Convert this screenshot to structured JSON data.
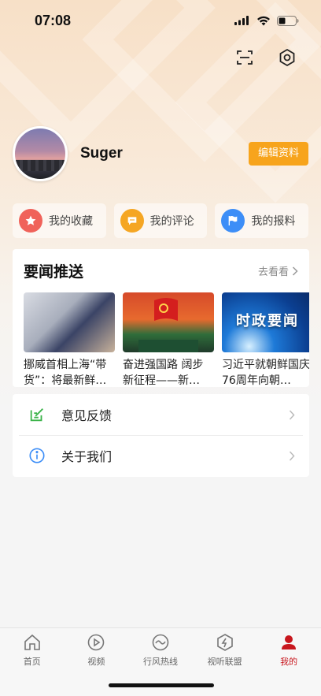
{
  "status_bar": {
    "time": "07:08"
  },
  "profile": {
    "username": "Suger",
    "edit_label": "编辑资料"
  },
  "quick_actions": [
    {
      "label": "我的收藏",
      "icon": "star-icon",
      "color": "#f0625a"
    },
    {
      "label": "我的评论",
      "icon": "comment-icon",
      "color": "#f5a623"
    },
    {
      "label": "我的报料",
      "icon": "flag-icon",
      "color": "#3d8ef7"
    }
  ],
  "news": {
    "title": "要闻推送",
    "see_more": "去看看",
    "items": [
      {
        "caption": "挪威首相上海“带货”：将最新鲜…"
      },
      {
        "caption": "奋进强国路 阔步新征程——新…"
      },
      {
        "caption": "习近平就朝鲜国庆76周年向朝…",
        "thumb_text": "时政要闻"
      }
    ]
  },
  "menu": [
    {
      "label": "意见反馈",
      "icon": "feedback-icon"
    },
    {
      "label": "关于我们",
      "icon": "info-icon"
    }
  ],
  "tabbar": {
    "tabs": [
      {
        "label": "首页",
        "icon": "home-icon"
      },
      {
        "label": "视频",
        "icon": "play-icon"
      },
      {
        "label": "行风热线",
        "icon": "hotline-icon"
      },
      {
        "label": "视听联盟",
        "icon": "alliance-icon"
      },
      {
        "label": "我的",
        "icon": "user-icon",
        "active": true
      }
    ]
  },
  "colors": {
    "accent": "#f7a41c",
    "active_tab": "#c8171e"
  }
}
